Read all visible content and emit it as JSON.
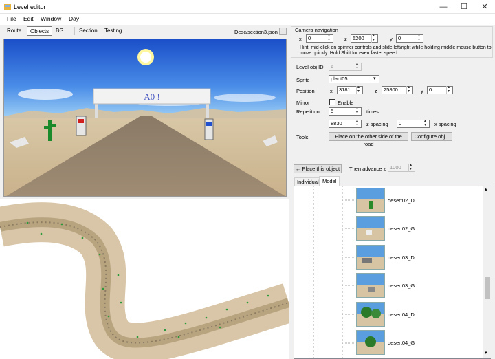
{
  "window": {
    "title": "Level editor"
  },
  "menu": [
    "File",
    "Edit",
    "Window",
    "Day"
  ],
  "tabs": [
    "Route",
    "Objects",
    "BG",
    "Section",
    "Testing"
  ],
  "selected_tab": "Objects",
  "file_label": "Desc/section3.json",
  "info_button": "i",
  "banner_text": "A0 !",
  "camera": {
    "title": "Camera navigation",
    "x_label": "x",
    "x_value": "0",
    "z_label": "z",
    "z_value": "5200",
    "y_label": "y",
    "y_value": "0",
    "hint": "Hint: mid-click on spinner controls and slide left/right while holding middle mouse button to move quickly. Hold Shift for even faster speed."
  },
  "object": {
    "id_label": "Level obj ID",
    "id_value": "6",
    "sprite_label": "Sprite",
    "sprite_value": "plant05",
    "position_label": "Position",
    "pos_x_label": "x",
    "pos_x": "3181",
    "pos_z_label": "z",
    "pos_z": "25800",
    "pos_y_label": "y",
    "pos_y": "0",
    "mirror_label": "Mirror",
    "enable_label": "Enable",
    "repetition_label": "Repetition",
    "repetition_value": "5",
    "times_label": "times",
    "zspacing_value": "8830",
    "zspacing_label": "z spacing",
    "xspacing_value": "0",
    "xspacing_label": "x spacing",
    "tools_label": "Tools",
    "other_side_button": "Place on the other side of the road",
    "configure_button": "Configure obj...",
    "place_button": "← Place this object",
    "advance_label": "Then advance z",
    "advance_value": "1000"
  },
  "subtabs": [
    "Individual",
    "Model"
  ],
  "selected_subtab": "Model",
  "models": [
    "desert02_D",
    "desert02_G",
    "desert03_D",
    "desert03_G",
    "desert04_D",
    "desert04_G"
  ]
}
